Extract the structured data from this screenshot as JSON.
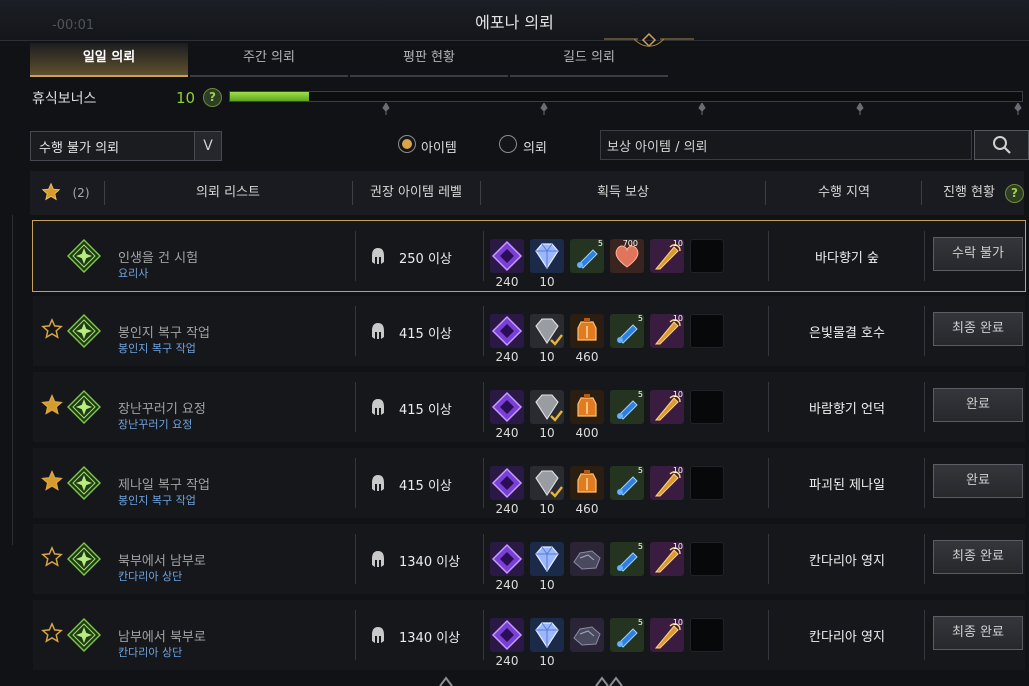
{
  "window": {
    "timer": "-00:01",
    "title": "에포나 의뢰"
  },
  "tabs": [
    {
      "label": "일일 의뢰",
      "active": true
    },
    {
      "label": "주간 의뢰",
      "active": false
    },
    {
      "label": "평판 현황",
      "active": false
    },
    {
      "label": "길드 의뢰",
      "active": false
    }
  ],
  "rest_bonus": {
    "label": "휴식보너스",
    "value": "10",
    "help": "?",
    "fill_fraction": 0.1
  },
  "filter": {
    "selected": "수행 불가 의뢰",
    "arrow": "V"
  },
  "view_mode": {
    "options": [
      {
        "label": "아이템",
        "selected": true
      },
      {
        "label": "의뢰",
        "selected": false
      }
    ]
  },
  "search": {
    "placeholder": "보상 아이템 / 의뢰"
  },
  "table_header": {
    "favorite_count": "(2)",
    "quest_list": "의뢰 리스트",
    "item_level": "권장 아이템 레벨",
    "rewards": "획득 보상",
    "region": "수행 지역",
    "status": "진행 현황",
    "help": "?"
  },
  "colors": {
    "accent_gold": "#c6a25c",
    "rest_green": "#8ed12e",
    "sub_blue": "#6fa4de"
  },
  "rows": [
    {
      "favorite": "none",
      "name": "인생을 건 시험",
      "sub": "요리사",
      "level": "250 이상",
      "rewards": [
        {
          "icon": "purple-crystal-icon",
          "count": "240",
          "badge": ""
        },
        {
          "icon": "blue-gem-icon",
          "count": "10",
          "badge": ""
        },
        {
          "icon": "blue-potion-icon",
          "count": "",
          "badge": "5"
        },
        {
          "icon": "red-heart-icon",
          "count": "",
          "badge": "700"
        },
        {
          "icon": "gold-horn-icon",
          "count": "",
          "badge": "10"
        },
        {
          "icon": "empty",
          "count": "",
          "badge": ""
        }
      ],
      "region": "바다향기 숲",
      "status": "수락 불가",
      "selected": true
    },
    {
      "favorite": "outline",
      "name": "봉인지 복구 작업",
      "sub": "봉인지 복구 작업",
      "level": "415 이상",
      "rewards": [
        {
          "icon": "purple-crystal-icon",
          "count": "240",
          "badge": ""
        },
        {
          "icon": "grey-gem-check-icon",
          "count": "10",
          "badge": ""
        },
        {
          "icon": "orange-lantern-icon",
          "count": "460",
          "badge": ""
        },
        {
          "icon": "blue-potion-icon",
          "count": "",
          "badge": "5"
        },
        {
          "icon": "gold-horn-icon",
          "count": "",
          "badge": "10"
        },
        {
          "icon": "empty",
          "count": "",
          "badge": ""
        }
      ],
      "region": "은빛물결 호수",
      "status": "최종 완료",
      "selected": false
    },
    {
      "favorite": "filled",
      "name": "장난꾸러기 요정",
      "sub": "장난꾸러기 요정",
      "level": "415 이상",
      "rewards": [
        {
          "icon": "purple-crystal-icon",
          "count": "240",
          "badge": ""
        },
        {
          "icon": "grey-gem-check-icon",
          "count": "10",
          "badge": ""
        },
        {
          "icon": "orange-lantern-icon",
          "count": "400",
          "badge": ""
        },
        {
          "icon": "blue-potion-icon",
          "count": "",
          "badge": "5"
        },
        {
          "icon": "gold-horn-icon",
          "count": "",
          "badge": "10"
        },
        {
          "icon": "empty",
          "count": "",
          "badge": ""
        }
      ],
      "region": "바람향기 언덕",
      "status": "완료",
      "selected": false
    },
    {
      "favorite": "filled",
      "name": "제나일 복구 작업",
      "sub": "봉인지 복구 작업",
      "level": "415 이상",
      "rewards": [
        {
          "icon": "purple-crystal-icon",
          "count": "240",
          "badge": ""
        },
        {
          "icon": "grey-gem-check-icon",
          "count": "10",
          "badge": ""
        },
        {
          "icon": "orange-lantern-icon",
          "count": "460",
          "badge": ""
        },
        {
          "icon": "blue-potion-icon",
          "count": "",
          "badge": "5"
        },
        {
          "icon": "gold-horn-icon",
          "count": "",
          "badge": "10"
        },
        {
          "icon": "empty",
          "count": "",
          "badge": ""
        }
      ],
      "region": "파괴된 제나일",
      "status": "완료",
      "selected": false
    },
    {
      "favorite": "outline",
      "name": "북부에서 남부로",
      "sub": "칸다리아 상단",
      "level": "1340 이상",
      "rewards": [
        {
          "icon": "purple-crystal-icon",
          "count": "240",
          "badge": ""
        },
        {
          "icon": "blue-gem-icon",
          "count": "10",
          "badge": ""
        },
        {
          "icon": "dark-ore-icon",
          "count": "",
          "badge": ""
        },
        {
          "icon": "blue-potion-icon",
          "count": "",
          "badge": "5"
        },
        {
          "icon": "gold-horn-icon",
          "count": "",
          "badge": "10"
        },
        {
          "icon": "empty",
          "count": "",
          "badge": ""
        }
      ],
      "region": "칸다리아 영지",
      "status": "최종 완료",
      "selected": false
    },
    {
      "favorite": "outline",
      "name": "남부에서 북부로",
      "sub": "칸다리아 상단",
      "level": "1340 이상",
      "rewards": [
        {
          "icon": "purple-crystal-icon",
          "count": "240",
          "badge": ""
        },
        {
          "icon": "blue-gem-icon",
          "count": "10",
          "badge": ""
        },
        {
          "icon": "dark-ore-icon",
          "count": "",
          "badge": ""
        },
        {
          "icon": "blue-potion-icon",
          "count": "",
          "badge": "5"
        },
        {
          "icon": "gold-horn-icon",
          "count": "",
          "badge": "10"
        },
        {
          "icon": "empty",
          "count": "",
          "badge": ""
        }
      ],
      "region": "칸다리아 영지",
      "status": "최종 완료",
      "selected": false
    }
  ]
}
